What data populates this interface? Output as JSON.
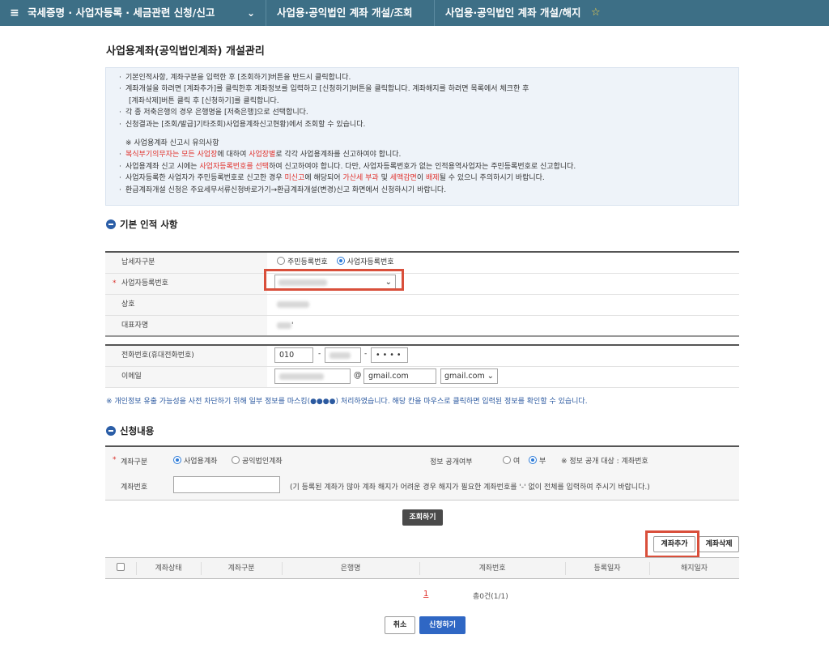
{
  "topbar": {
    "menu_icon": "≡",
    "crumb1": "국세증명 · 사업자등록 · 세금관련 신청/신고",
    "chevron": "⌄",
    "crumb2": "사업용·공익법인 계좌 개설/조회",
    "crumb3": "사업용·공익법인 계좌 개설/해지",
    "star": "☆"
  },
  "page_title": "사업용계좌(공익법인계좌) 개설관리",
  "notice": {
    "l1": "기본인적사항, 계좌구분을 입력한 후 [조회하기]버튼을 반드시 클릭합니다.",
    "l2": "계좌개설을 하려면 [계좌추가]를 클릭한후 계좌정보를 입력하고 [신청하기]버튼을 클릭합니다. 계좌해지를 하려면 목록에서 체크한 후",
    "l3": "[계좌삭제]버튼 클릭 후 [신청하기]를 클릭합니다.",
    "l4": "각 종 저축은행의 경우 은행명을 [저축은행]으로 선택합니다.",
    "l5": "신청결과는 [조회/발급]기타조회)사업용계좌신고현황)에서 조회할 수 있습니다.",
    "w_title": "※ 사업용계좌 신고시 유의사항",
    "w1_red": "복식부기의무자는 모든 사업장",
    "w1_mid": "에 대하여 ",
    "w1_red2": "사업장별",
    "w1_end": "로 각각 사업용계좌를 신고하여야 합니다.",
    "w2_a": "사업용계좌 신고 시에는 ",
    "w2_red": "사업자등록번호를 선택",
    "w2_b": "하여 신고하여야 합니다. 다만, 사업자등록번호가 없는 인적용역사업자는 주민등록번호로 신고합니다.",
    "w3_a": "사업자등록한 사업자가 주민등록번호로 신고한 경우 ",
    "w3_red1": "미신고",
    "w3_b": "에 해당되어 ",
    "w3_red2": "가산세 부과",
    "w3_c": " 및 ",
    "w3_red3": "세액감면",
    "w3_d": "이 ",
    "w3_red4": "배제",
    "w3_e": "될 수 있으니 주의하시기 바랍니다.",
    "w4": "환급계좌개설 신청은 주요세무서류신청바로가기→환급계좌개설(변경)신고 화면에서 신청하시기 바랍니다."
  },
  "basic": {
    "title": "기본 인적 사항",
    "taxpayer_type_label": "납세자구분",
    "opt_resident": "주민등록번호",
    "opt_business": "사업자등록번호",
    "bizno_label": "사업자등록번호",
    "required_mark": "*",
    "trade_name_label": "상호",
    "rep_name_label": "대표자명",
    "rep_name_suffix": "'",
    "phone_label": "전화번호(휴대전화번호)",
    "phone1": "010",
    "phone_dash": "-",
    "phone3": "• • • •",
    "email_label": "이메일",
    "email_at": "@",
    "email_domain": "gmail.com",
    "email_domain_select": "gmail.com"
  },
  "mask_note": "※ 개인정보 유출 가능성을 사전 차단하기 위해 일부 정보를 마스킹(●●●●) 처리하였습니다. 해당 칸을 마우스로 클릭하면 입력된 정보를 확인할 수 있습니다.",
  "apply": {
    "title": "신청내용",
    "account_type_label": "계좌구분",
    "opt_business_account": "사업용계좌",
    "opt_public_account": "공익법인계좌",
    "disclosure_label": "정보 공개여부",
    "opt_yes": "여",
    "opt_no": "부",
    "disclosure_note": "※ 정보 공개 대상 : 계좌번호",
    "account_no_label": "계좌번호",
    "account_no_hint": "(기 등록된 계좌가 많아 계좌 해지가 어려운 경우 해지가 필요한 계좌번호를 '-' 없이 전체를 입력하여 주시기 바랍니다.)"
  },
  "buttons": {
    "inquiry": "조회하기",
    "add_account": "계좌추가",
    "delete_account": "계좌삭제",
    "cancel": "취소",
    "submit": "신청하기"
  },
  "table": {
    "headers": [
      "계좌상태",
      "계좌구분",
      "은행명",
      "계좌번호",
      "등록일자",
      "해지일자"
    ],
    "page": "1",
    "total": "총0건(1/1)"
  },
  "colors": {
    "topbar": "#3d6f86",
    "accent_blue": "#2f67c4",
    "highlight": "#d94f3b",
    "warning_red": "#e0322d"
  }
}
